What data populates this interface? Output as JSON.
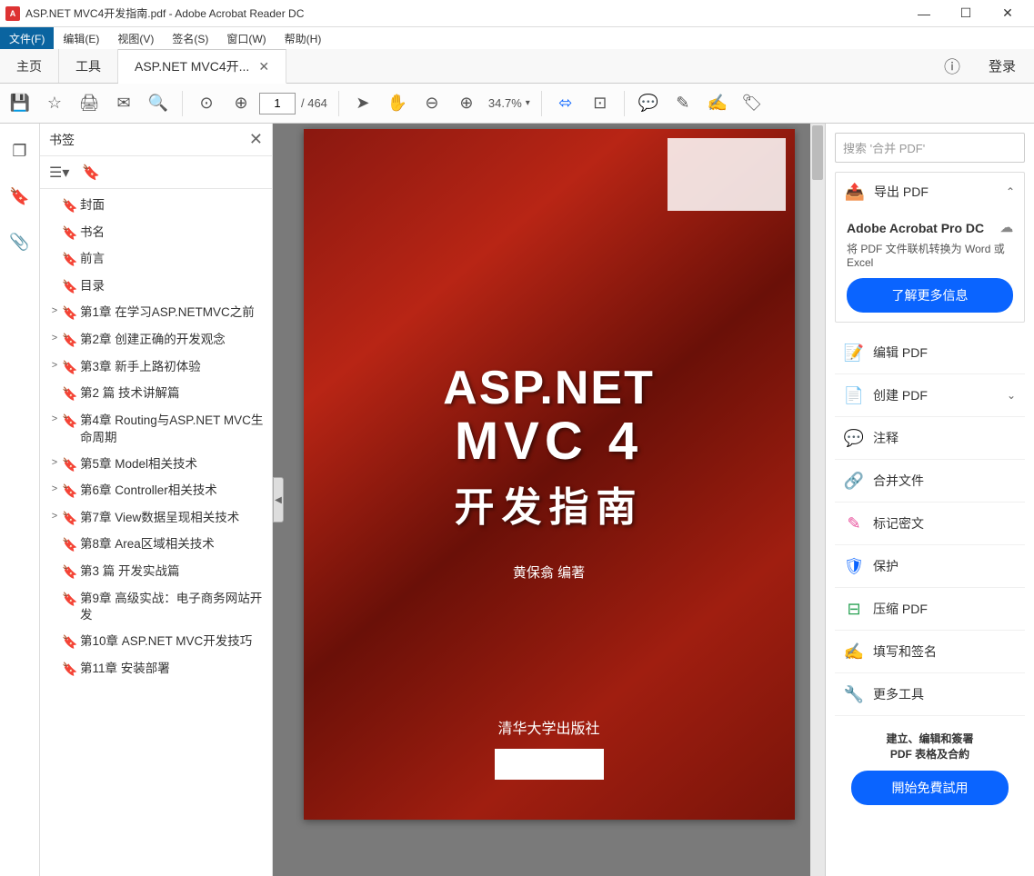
{
  "window": {
    "title": "ASP.NET MVC4开发指南.pdf - Adobe Acrobat Reader DC"
  },
  "menu": {
    "file": "文件(F)",
    "items": [
      "编辑(E)",
      "视图(V)",
      "签名(S)",
      "窗口(W)",
      "帮助(H)"
    ]
  },
  "tabs": {
    "home": "主页",
    "tools": "工具",
    "doc": "ASP.NET MVC4开...",
    "login": "登录"
  },
  "toolbar": {
    "page_current": "1",
    "page_total": "/ 464",
    "zoom": "34.7%"
  },
  "bookmarks": {
    "title": "书签",
    "items": [
      {
        "exp": "",
        "label": "封面"
      },
      {
        "exp": "",
        "label": "书名"
      },
      {
        "exp": "",
        "label": "前言"
      },
      {
        "exp": "",
        "label": "目录"
      },
      {
        "exp": ">",
        "label": "第1章 在学习ASP.NETMVC之前"
      },
      {
        "exp": ">",
        "label": "第2章 创建正确的开发观念"
      },
      {
        "exp": ">",
        "label": "第3章 新手上路初体验"
      },
      {
        "exp": "",
        "label": "第2 篇 技术讲解篇"
      },
      {
        "exp": ">",
        "label": "第4章 Routing与ASP.NET MVC生命周期"
      },
      {
        "exp": ">",
        "label": "第5章 Model相关技术"
      },
      {
        "exp": ">",
        "label": "第6章 Controller相关技术"
      },
      {
        "exp": ">",
        "label": "第7章 View数据呈现相关技术"
      },
      {
        "exp": "",
        "label": "第8章 Area区域相关技术"
      },
      {
        "exp": "",
        "label": "第3 篇 开发实战篇"
      },
      {
        "exp": "",
        "label": "第9章 高级实战：电子商务网站开发"
      },
      {
        "exp": "",
        "label": "第10章 ASP.NET MVC开发技巧"
      },
      {
        "exp": "",
        "label": "第11章 安装部署"
      }
    ]
  },
  "cover": {
    "t1": "ASP.NET",
    "t2": "MVC 4",
    "t3": "开发指南",
    "author": "黄保翕  编著",
    "publisher": "清华大学出版社"
  },
  "right": {
    "search_placeholder": "搜索 '合并 PDF'",
    "export": {
      "title": "导出 PDF",
      "product": "Adobe Acrobat Pro DC",
      "desc": "将 PDF 文件联机转换为 Word 或 Excel",
      "cta": "了解更多信息"
    },
    "tools": [
      {
        "icon": "📝",
        "cls": "c-pink",
        "label": "编辑 PDF"
      },
      {
        "icon": "📄",
        "cls": "c-red",
        "label": "创建 PDF",
        "chev": "⌄"
      },
      {
        "icon": "💬",
        "cls": "c-orange",
        "label": "注释"
      },
      {
        "icon": "🔗",
        "cls": "c-purple",
        "label": "合并文件"
      },
      {
        "icon": "✎",
        "cls": "c-pink",
        "label": "标记密文"
      },
      {
        "icon": "🛡",
        "cls": "c-blue",
        "label": "保护"
      },
      {
        "icon": "⊟",
        "cls": "c-green",
        "label": "压缩 PDF"
      },
      {
        "icon": "✍",
        "cls": "c-purple",
        "label": "填写和签名"
      },
      {
        "icon": "🔧",
        "cls": "c-gray",
        "label": "更多工具"
      }
    ],
    "promo": {
      "line1": "建立、编辑和簽署",
      "line2": "PDF 表格及合約",
      "cta": "開始免費試用"
    }
  }
}
